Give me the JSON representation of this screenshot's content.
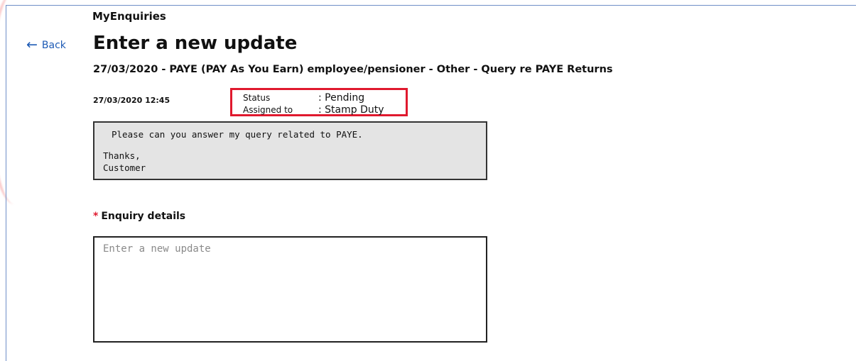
{
  "header": {
    "breadcrumb": "MyEnquiries",
    "back_label": "Back",
    "title": "Enter a new update",
    "subtitle": "27/03/2020 - PAYE (PAY As You Earn) employee/pensioner - Other - Query re PAYE Returns"
  },
  "enquiry": {
    "timestamp": "27/03/2020 12:45",
    "status_label": "Status",
    "status_value": ": Pending",
    "assigned_label": "Assigned to",
    "assigned_value": ": Stamp Duty",
    "highlight_color": "#e0192e",
    "message": {
      "line1": "Please can you answer my query related to PAYE.",
      "line2": "Thanks,",
      "line3": "Customer"
    }
  },
  "form": {
    "required_marker": "*",
    "details_label": "Enquiry details",
    "details_placeholder": "Enter a new update",
    "details_value": ""
  },
  "icons": {
    "back": "arrow-left-icon"
  }
}
